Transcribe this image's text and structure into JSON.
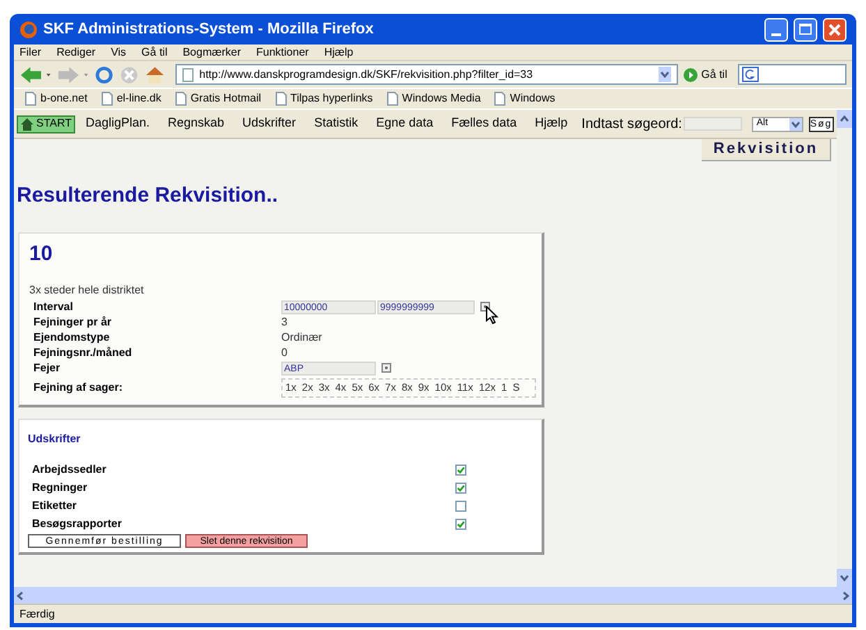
{
  "window": {
    "title": "SKF Administrations-System - Mozilla Firefox"
  },
  "menu": [
    "Filer",
    "Rediger",
    "Vis",
    "Gå til",
    "Bogmærker",
    "Funktioner",
    "Hjælp"
  ],
  "navigation": {
    "url": "http://www.danskprogramdesign.dk/SKF/rekvisition.php?filter_id=33",
    "go_label": "Gå til"
  },
  "bookmarks": [
    "b-one.net",
    "el-line.dk",
    "Gratis Hotmail",
    "Tilpas hyperlinks",
    "Windows Media",
    "Windows"
  ],
  "site_nav": {
    "start": "START",
    "items": [
      "DagligPlan.",
      "Regnskab",
      "Udskrifter",
      "Statistik",
      "Egne data",
      "Fælles data",
      "Hjælp"
    ],
    "search_label": "Indtast søgeord:",
    "scope": "Alt",
    "search_button": "Søg"
  },
  "tab": "Rekvisition",
  "heading": "Resulterende Rekvisition..",
  "card": {
    "number": "10",
    "description": "3x steder hele distriktet",
    "rows": [
      {
        "kind": "range",
        "label": "Interval",
        "from": "10000000",
        "to": "9999999999"
      },
      {
        "kind": "text",
        "label": "Fejninger pr år",
        "value": "3"
      },
      {
        "kind": "text",
        "label": "Ejendomstype",
        "value": "Ordinær"
      },
      {
        "kind": "text",
        "label": "Fejningsnr./måned",
        "value": "0"
      },
      {
        "kind": "input",
        "label": "Fejer",
        "value": "ABP"
      },
      {
        "kind": "months",
        "label": "Fejning af sager:",
        "values": [
          "1x",
          "2x",
          "3x",
          "4x",
          "5x",
          "6x",
          "7x",
          "8x",
          "9x",
          "10x",
          "11x",
          "12x",
          "1",
          "S"
        ]
      }
    ]
  },
  "prints": {
    "title": "Udskrifter",
    "items": [
      {
        "label": "Arbejdssedler",
        "checked": true
      },
      {
        "label": "Regninger",
        "checked": true
      },
      {
        "label": "Etiketter",
        "checked": false
      },
      {
        "label": "Besøgsrapporter",
        "checked": true
      }
    ]
  },
  "buttons": [
    {
      "kind": "primary",
      "label": "Gennemfør bestilling"
    },
    {
      "kind": "danger",
      "label": "Slet denne rekvisition"
    }
  ],
  "status_bar": "Færdig"
}
